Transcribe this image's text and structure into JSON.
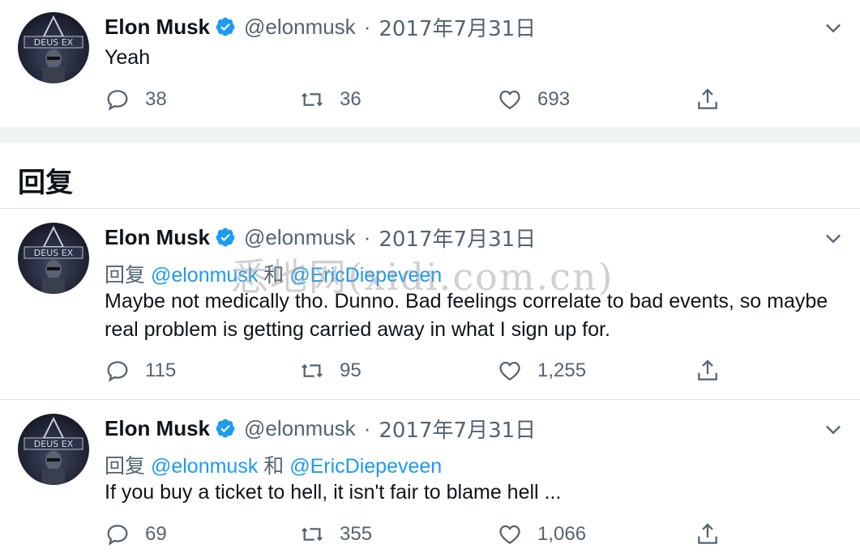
{
  "colors": {
    "accent": "#1d9bf0",
    "secondary_text": "#536471",
    "primary_text": "#0f1419",
    "divider": "#eff3f4"
  },
  "section_title": "回复",
  "watermark": "悉地网(xidi.com.cn)",
  "tweets": [
    {
      "name": "Elon Musk",
      "handle": "@elonmusk",
      "separator": "·",
      "date": "2017年7月31日",
      "reply_prefix": "",
      "reply_mention1": "",
      "reply_and": "",
      "reply_mention2": "",
      "text": "Yeah",
      "replies": "38",
      "retweets": "36",
      "likes": "693"
    },
    {
      "name": "Elon Musk",
      "handle": "@elonmusk",
      "separator": "·",
      "date": "2017年7月31日",
      "reply_prefix": "回复 ",
      "reply_mention1": "@elonmusk",
      "reply_and": " 和 ",
      "reply_mention2": "@EricDiepeveen",
      "text": "Maybe not medically tho. Dunno. Bad feelings correlate to bad events, so maybe real problem is getting carried away in what I sign up for.",
      "replies": "115",
      "retweets": "95",
      "likes": "1,255"
    },
    {
      "name": "Elon Musk",
      "handle": "@elonmusk",
      "separator": "·",
      "date": "2017年7月31日",
      "reply_prefix": "回复 ",
      "reply_mention1": "@elonmusk",
      "reply_and": " 和 ",
      "reply_mention2": "@EricDiepeveen",
      "text": "If you buy a ticket to hell, it isn't fair to blame hell ...",
      "replies": "69",
      "retweets": "355",
      "likes": "1,066"
    }
  ],
  "icons": {
    "avatar_text": "DEUS EX",
    "reply": "reply-icon",
    "retweet": "retweet-icon",
    "like": "heart-icon",
    "share": "share-icon",
    "more": "chevron-down-icon",
    "verified": "verified-badge-icon"
  }
}
